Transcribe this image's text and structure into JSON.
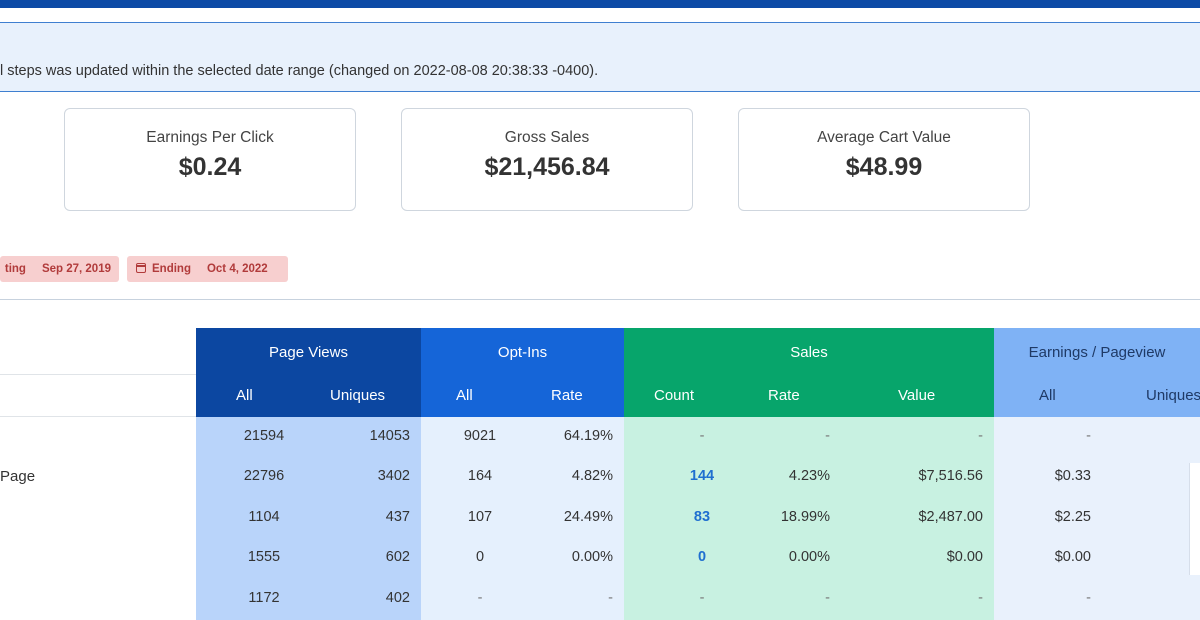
{
  "notice": {
    "text": "l steps was updated within the selected date range (changed on 2022-08-08 20:38:33 -0400)."
  },
  "cards": [
    {
      "label": "Earnings Per Click",
      "value": "$0.24"
    },
    {
      "label": "Gross Sales",
      "value": "$21,456.84"
    },
    {
      "label": "Average Cart Value",
      "value": "$48.99"
    }
  ],
  "date_range": {
    "start_label": "ting",
    "start_value": "Sep 27, 2019",
    "end_label": "Ending",
    "end_value": "Oct 4, 2022",
    "icon": "calendar-icon"
  },
  "table": {
    "groups": [
      "Page Views",
      "Opt-Ins",
      "Sales",
      "Earnings / Pageview"
    ],
    "subheaders": [
      "All",
      "Uniques",
      "All",
      "Rate",
      "Count",
      "Rate",
      "Value",
      "All",
      "Uniques"
    ],
    "row_labels": [
      "",
      "Page",
      "",
      "",
      ""
    ],
    "rows": [
      [
        "21594",
        "14053",
        "9021",
        "64.19%",
        "-",
        "-",
        "-",
        "-"
      ],
      [
        "22796",
        "3402",
        "164",
        "4.82%",
        "144",
        "4.23%",
        "$7,516.56",
        "$0.33"
      ],
      [
        "1104",
        "437",
        "107",
        "24.49%",
        "83",
        "18.99%",
        "$2,487.00",
        "$2.25"
      ],
      [
        "1555",
        "602",
        "0",
        "0.00%",
        "0",
        "0.00%",
        "$0.00",
        "$0.00"
      ],
      [
        "1172",
        "402",
        "-",
        "-",
        "-",
        "-",
        "-",
        "-"
      ]
    ]
  },
  "colors": {
    "page_views_header": "#0c47a1",
    "optins_header": "#1565d8",
    "sales_header": "#07a56b",
    "earnings_header": "#7fb2f5",
    "page_views_body": "#b9d4fa",
    "optins_body": "#e5f0fd",
    "sales_body": "#c8f1e1",
    "earnings_body": "#e9f1fc"
  }
}
